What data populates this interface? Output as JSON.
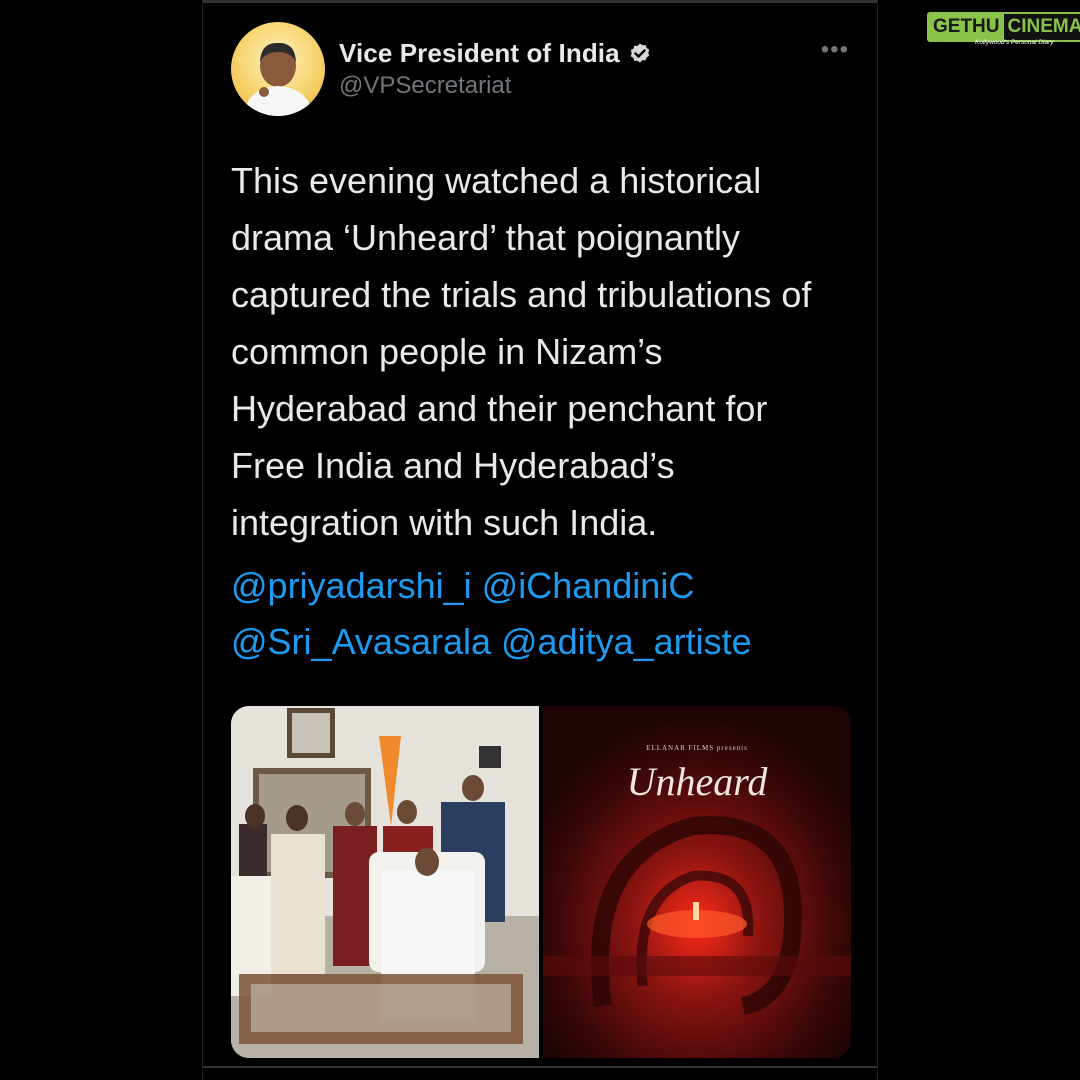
{
  "account": {
    "name": "Vice President of India",
    "handle": "@VPSecretariat"
  },
  "tweet": {
    "text": "This evening watched a historical\ndrama ‘Unheard’ that poignantly\ncaptured the trials and tribulations of\ncommon people in Nizam’s\nHyderabad and their penchant for\nFree India and Hyderabad’s\nintegration with such India.",
    "mentions_line1": [
      "@priyadarshi_i",
      "@iChandiniC"
    ],
    "mentions_line2": [
      "@Sri_Avasarala",
      "@aditya_artiste"
    ]
  },
  "media": {
    "poster_caption": "ELLANAR FILMS presents",
    "poster_title": "Unheard"
  },
  "watermark": {
    "part1": "GETHU",
    "part2": "CINEMA",
    "tagline": "Kollywood's Personal Diary"
  },
  "colors": {
    "link": "#1d9bf0",
    "text": "#e7e9ea",
    "muted": "#71767b",
    "brand_green": "#8bc34a"
  },
  "icons": {
    "verified": "verified-badge-icon",
    "more": "more-options-icon"
  }
}
